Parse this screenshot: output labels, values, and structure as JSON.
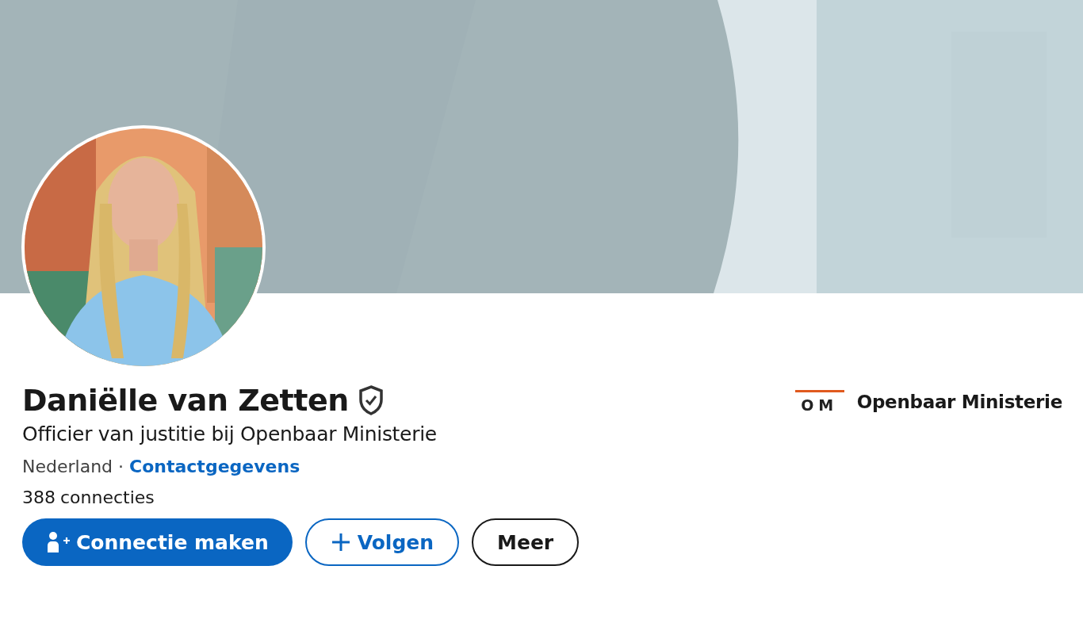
{
  "profile": {
    "name": "Daniëlle van Zetten",
    "verified": true,
    "headline": "Officier van justitie bij Openbaar Ministerie",
    "location": "Nederland",
    "separator": "·",
    "contact_link": "Contactgegevens",
    "connections_count": "388",
    "connections_label": "connecties"
  },
  "organization": {
    "logo_text": "OM",
    "name": "Openbaar Ministerie"
  },
  "actions": [
    {
      "kind": "primary",
      "label": "Connectie maken"
    },
    {
      "kind": "outline",
      "label": "Volgen"
    },
    {
      "kind": "plain",
      "label": "Meer"
    }
  ]
}
